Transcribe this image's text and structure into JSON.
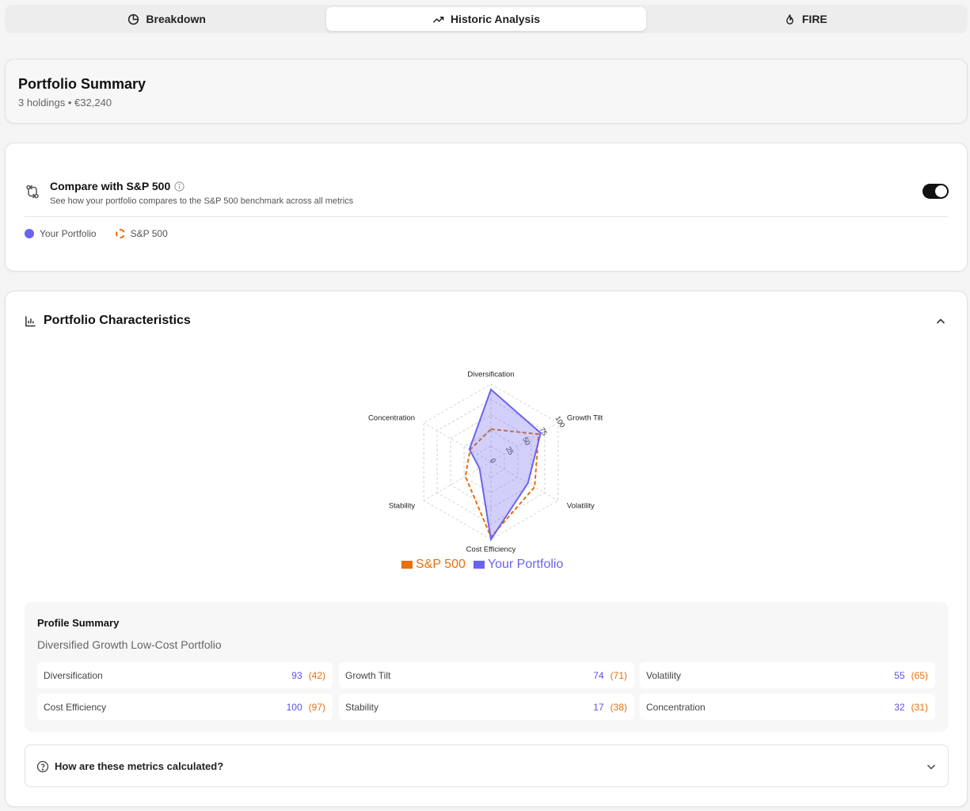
{
  "tabs": [
    {
      "label": "Breakdown",
      "icon": "pie-chart-icon"
    },
    {
      "label": "Historic Analysis",
      "icon": "trending-up-icon"
    },
    {
      "label": "FIRE",
      "icon": "flame-icon"
    }
  ],
  "active_tab": "Historic Analysis",
  "summary": {
    "title": "Portfolio Summary",
    "subtitle": "3 holdings • €32,240"
  },
  "compare": {
    "title": "Compare with S&P 500",
    "description": "See how your portfolio compares to the S&P 500 benchmark across all metrics",
    "toggle_on": true,
    "legend": {
      "portfolio": "Your Portfolio",
      "benchmark": "S&P 500"
    }
  },
  "characteristics": {
    "title": "Portfolio Characteristics",
    "expanded": true
  },
  "colors": {
    "portfolio": "#6b63f0",
    "benchmark": "#e8700c"
  },
  "chart_data": {
    "type": "radar",
    "axes": [
      "Diversification",
      "Growth Tilt",
      "Volatility",
      "Cost Efficiency",
      "Stability",
      "Concentration"
    ],
    "radial_ticks": [
      "0",
      "25",
      "50",
      "75",
      "100"
    ],
    "range": [
      0,
      100
    ],
    "series": [
      {
        "name": "S&P 500",
        "values": [
          42,
          71,
          65,
          97,
          38,
          31
        ],
        "style": "dashed"
      },
      {
        "name": "Your Portfolio",
        "values": [
          93,
          74,
          55,
          100,
          17,
          32
        ],
        "style": "filled"
      }
    ],
    "legend_position": "bottom"
  },
  "profile": {
    "title": "Profile Summary",
    "type": "Diversified Growth Low-Cost Portfolio",
    "metrics": [
      {
        "label": "Diversification",
        "value": "93",
        "benchmark": "(42)"
      },
      {
        "label": "Growth Tilt",
        "value": "74",
        "benchmark": "(71)"
      },
      {
        "label": "Volatility",
        "value": "55",
        "benchmark": "(65)"
      },
      {
        "label": "Cost Efficiency",
        "value": "100",
        "benchmark": "(97)"
      },
      {
        "label": "Stability",
        "value": "17",
        "benchmark": "(38)"
      },
      {
        "label": "Concentration",
        "value": "32",
        "benchmark": "(31)"
      }
    ]
  },
  "faq": {
    "question": "How are these metrics calculated?"
  }
}
